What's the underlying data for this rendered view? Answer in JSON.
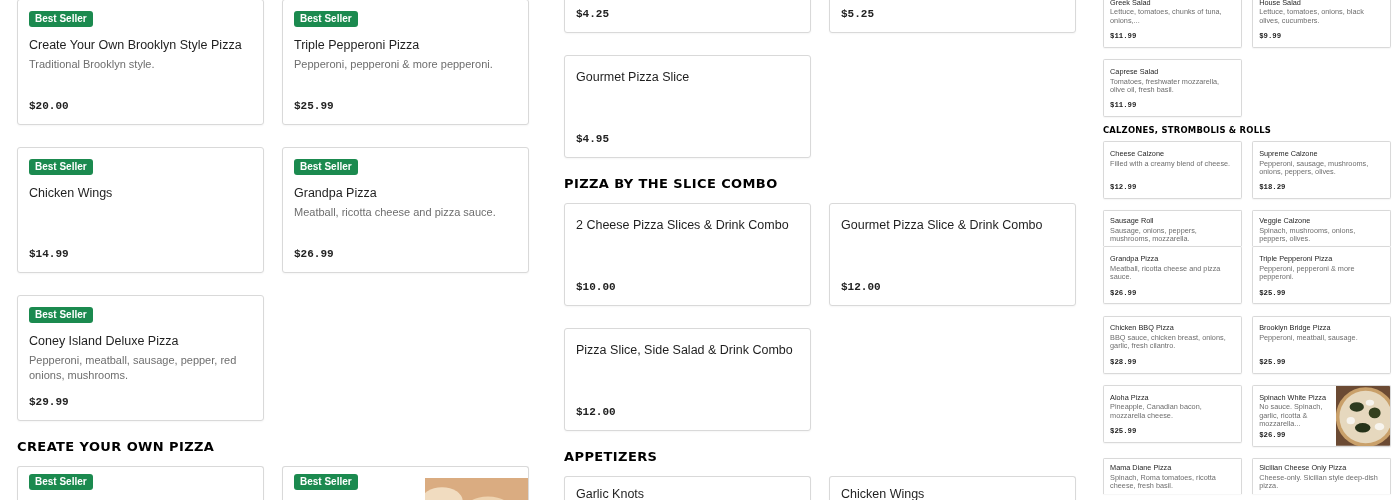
{
  "panels": [
    {
      "blocks": [
        {
          "kind": "cards",
          "cards": [
            {
              "badge": "Best Seller",
              "title": "Create Your Own Brooklyn Style Pizza",
              "description": "Traditional Brooklyn style.",
              "price": "$20.00",
              "kind": "plain"
            },
            {
              "badge": "Best Seller",
              "title": "Triple Pepperoni Pizza",
              "description": "Pepperoni, pepperoni & more pepperoni.",
              "price": "$25.99",
              "kind": "plain"
            }
          ]
        },
        {
          "kind": "cards",
          "cards": [
            {
              "badge": "Best Seller",
              "title": "Chicken Wings",
              "price": "$14.99",
              "kind": "plain"
            },
            {
              "badge": "Best Seller",
              "title": "Grandpa Pizza",
              "description": "Meatball, ricotta cheese and pizza sauce.",
              "price": "$26.99",
              "kind": "plain"
            }
          ]
        },
        {
          "kind": "cards",
          "cards": [
            {
              "badge": "Best Seller",
              "title": "Coney Island Deluxe Pizza",
              "description": "Pepperoni, meatball, sausage, pepper, red onions, mushrooms.",
              "price": "$29.99",
              "kind": "plain"
            }
          ]
        },
        {
          "kind": "heading",
          "text": "CREATE YOUR OWN PIZZA"
        },
        {
          "kind": "cards",
          "cards": [
            {
              "badge": "Best Seller",
              "kind": "plain"
            },
            {
              "badge": "Best Seller",
              "kind": "picture"
            }
          ]
        }
      ]
    },
    {
      "blocks": [
        {
          "kind": "cards",
          "cards": [
            {
              "price": "$4.25",
              "kind": "plain"
            },
            {
              "price": "$5.25",
              "kind": "plain"
            }
          ]
        },
        {
          "kind": "cards",
          "cards": [
            {
              "title": "Gourmet Pizza Slice",
              "price": "$4.95",
              "kind": "plain"
            }
          ]
        },
        {
          "kind": "heading",
          "text": "PIZZA BY THE SLICE COMBO"
        },
        {
          "kind": "cards",
          "cards": [
            {
              "title": "2 Cheese Pizza Slices & Drink Combo",
              "price": "$10.00",
              "kind": "plain"
            },
            {
              "title": "Gourmet Pizza Slice & Drink Combo",
              "price": "$12.00",
              "kind": "plain"
            }
          ]
        },
        {
          "kind": "cards",
          "cards": [
            {
              "title": "Pizza Slice, Side Salad & Drink Combo",
              "price": "$12.00",
              "kind": "plain"
            }
          ]
        },
        {
          "kind": "heading",
          "text": "APPETIZERS"
        },
        {
          "kind": "cards",
          "cards": [
            {
              "title": "Garlic Knots",
              "kind": "plain"
            },
            {
              "title": "Chicken Wings",
              "kind": "plain"
            }
          ]
        }
      ]
    },
    {
      "blocks": [
        {
          "kind": "cards",
          "cards": [
            {
              "title": "Greek Salad",
              "description": "Lettuce, tomatoes, chunks of tuna, onions,...",
              "price": "$11.99",
              "kind": "plain"
            },
            {
              "title": "House Salad",
              "description": "Lettuce, tomatoes, onions, black olives, cucumbers.",
              "price": "$9.99",
              "kind": "plain"
            }
          ]
        },
        {
          "kind": "cards",
          "cards": [
            {
              "title": "Caprese Salad",
              "description": "Tomatoes, freshwater mozzarella, olive oil, fresh basil.",
              "price": "$11.99",
              "kind": "plain"
            }
          ]
        },
        {
          "kind": "heading",
          "text": "CALZONES, STROMBOLIS & ROLLS"
        },
        {
          "kind": "cards",
          "cards": [
            {
              "title": "Cheese Calzone",
              "description": "Filled with a creamy blend of cheese.",
              "price": "$12.99",
              "kind": "plain"
            },
            {
              "title": "Supreme Calzone",
              "description": "Pepperoni, sausage, mushrooms, onions, peppers, olives.",
              "price": "$18.29",
              "kind": "plain"
            }
          ]
        },
        {
          "kind": "cards",
          "cards": [
            {
              "title": "Sausage Roll",
              "description": "Sausage, onions, peppers, mushrooms, mozzarella.",
              "kind": "plain"
            },
            {
              "title": "Veggie Calzone",
              "description": "Spinach, mushrooms, onions, peppers, olives.",
              "kind": "plain"
            }
          ]
        },
        {
          "kind": "cards",
          "cards": [
            {
              "title": "Grandpa Pizza",
              "description": "Meatball, ricotta cheese and pizza sauce.",
              "price": "$26.99",
              "kind": "plain"
            },
            {
              "title": "Triple Pepperoni Pizza",
              "description": "Pepperoni, pepperoni & more pepperoni.",
              "price": "$25.99",
              "kind": "plain"
            }
          ]
        },
        {
          "kind": "cards",
          "cards": [
            {
              "title": "Chicken BBQ Pizza",
              "description": "BBQ sauce, chicken breast, onions, garlic, fresh cilantro.",
              "price": "$28.99",
              "kind": "plain"
            },
            {
              "title": "Brooklyn Bridge Pizza",
              "description": "Pepperoni, meatball, sausage.",
              "price": "$25.99",
              "kind": "plain"
            }
          ]
        },
        {
          "kind": "cards",
          "cards": [
            {
              "title": "Aloha Pizza",
              "description": "Pineapple, Canadian bacon, mozzarella cheese.",
              "price": "$25.99",
              "kind": "plain"
            },
            {
              "title": "Spinach White Pizza",
              "description": "No sauce. Spinach, garlic, ricotta & mozzarella...",
              "price": "$26.99",
              "kind": "picture"
            }
          ]
        },
        {
          "kind": "cards",
          "cards": [
            {
              "title": "Mama Diane Pizza",
              "description": "Spinach, Roma tomatoes, ricotta cheese, fresh basil.",
              "kind": "plain"
            },
            {
              "title": "Sicilian Cheese Only Pizza",
              "description": "Cheese-only. Sicilian style deep-dish pizza.",
              "kind": "plain"
            }
          ]
        }
      ]
    }
  ]
}
